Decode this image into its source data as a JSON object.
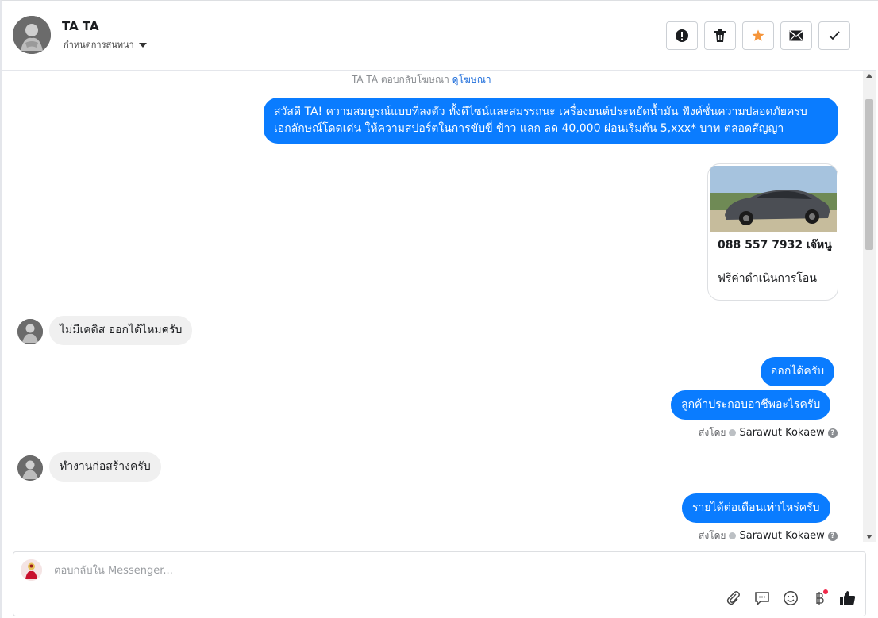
{
  "header": {
    "contact_name": "TA TA",
    "assign_label": "กำหนดการสนทนา",
    "actions": [
      {
        "name": "mark-spam",
        "icon": "exclamation-icon"
      },
      {
        "name": "delete",
        "icon": "trash-icon"
      },
      {
        "name": "star",
        "icon": "star-icon",
        "color": "#f5953b"
      },
      {
        "name": "mark-unread",
        "icon": "envelope-icon"
      },
      {
        "name": "mark-done",
        "icon": "checkmark-icon"
      }
    ]
  },
  "conversation": {
    "ad_reply_note": "TA TA ตอบกลับโฆษณา",
    "ad_view_link": "ดูโฆษณา",
    "messages": [
      {
        "direction": "out",
        "text": "สวัสดี TA! ความสมบูรณ์แบบที่ลงตัว ทั้งดีไซน์และสมรรถนะ เครื่องยนต์ประหยัดน้ำมัน ฟังค์ชั่นความปลอดภัยครบ เอกลักษณ์โดดเด่น ให้ความสปอร์ตในการขับขี่ ข้าว แลก ลด 40,000 ผ่อนเริ่มต้น 5,xxx* บาท ตลอดสัญญา"
      },
      {
        "direction": "out",
        "type": "card",
        "line1": "088 557 7932 เจ๊หนู",
        "line2": "ฟรีค่าดำเนินการโอน"
      },
      {
        "direction": "in",
        "text": "ไม่มีเคดิส ออกได้ไหมครับ"
      },
      {
        "direction": "out",
        "text": "ออกได้ครับ"
      },
      {
        "direction": "out",
        "text": "ลูกค้าประกอบอาชีพอะไรครับ"
      },
      {
        "direction": "in",
        "text": "ทำงานก่อสร้างครับ"
      },
      {
        "direction": "out",
        "text": "รายได้ต่อเดือนเท่าไหร่ครับ"
      }
    ],
    "sent_by_label": "ส่งโดย",
    "sent_by_name": "Sarawut Kokaew"
  },
  "composer": {
    "placeholder": "ตอบกลับใน Messenger...",
    "tools": [
      "paperclip-icon",
      "speech-bubble-icon",
      "smiley-icon",
      "baht-icon",
      "thumbs-up-icon"
    ]
  },
  "colors": {
    "outgoing_bubble": "#0a7cff",
    "incoming_bubble": "#f0f0f0",
    "link": "#216fdb"
  }
}
